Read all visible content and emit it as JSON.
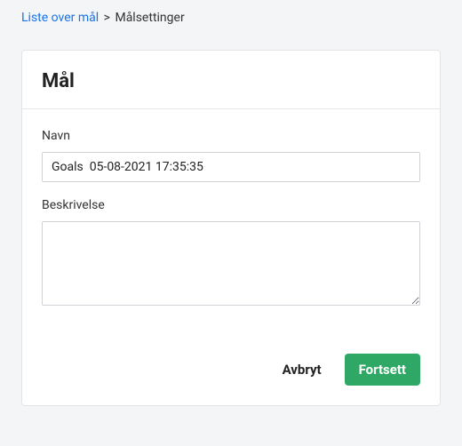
{
  "breadcrumb": {
    "link_text": "Liste over mål",
    "separator": ">",
    "current": "Målsettinger"
  },
  "card": {
    "title": "Mål"
  },
  "form": {
    "name": {
      "label": "Navn",
      "value": "Goals  05-08-2021 17:35:35"
    },
    "description": {
      "label": "Beskrivelse",
      "value": ""
    }
  },
  "buttons": {
    "cancel": "Avbryt",
    "continue": "Fortsett"
  }
}
